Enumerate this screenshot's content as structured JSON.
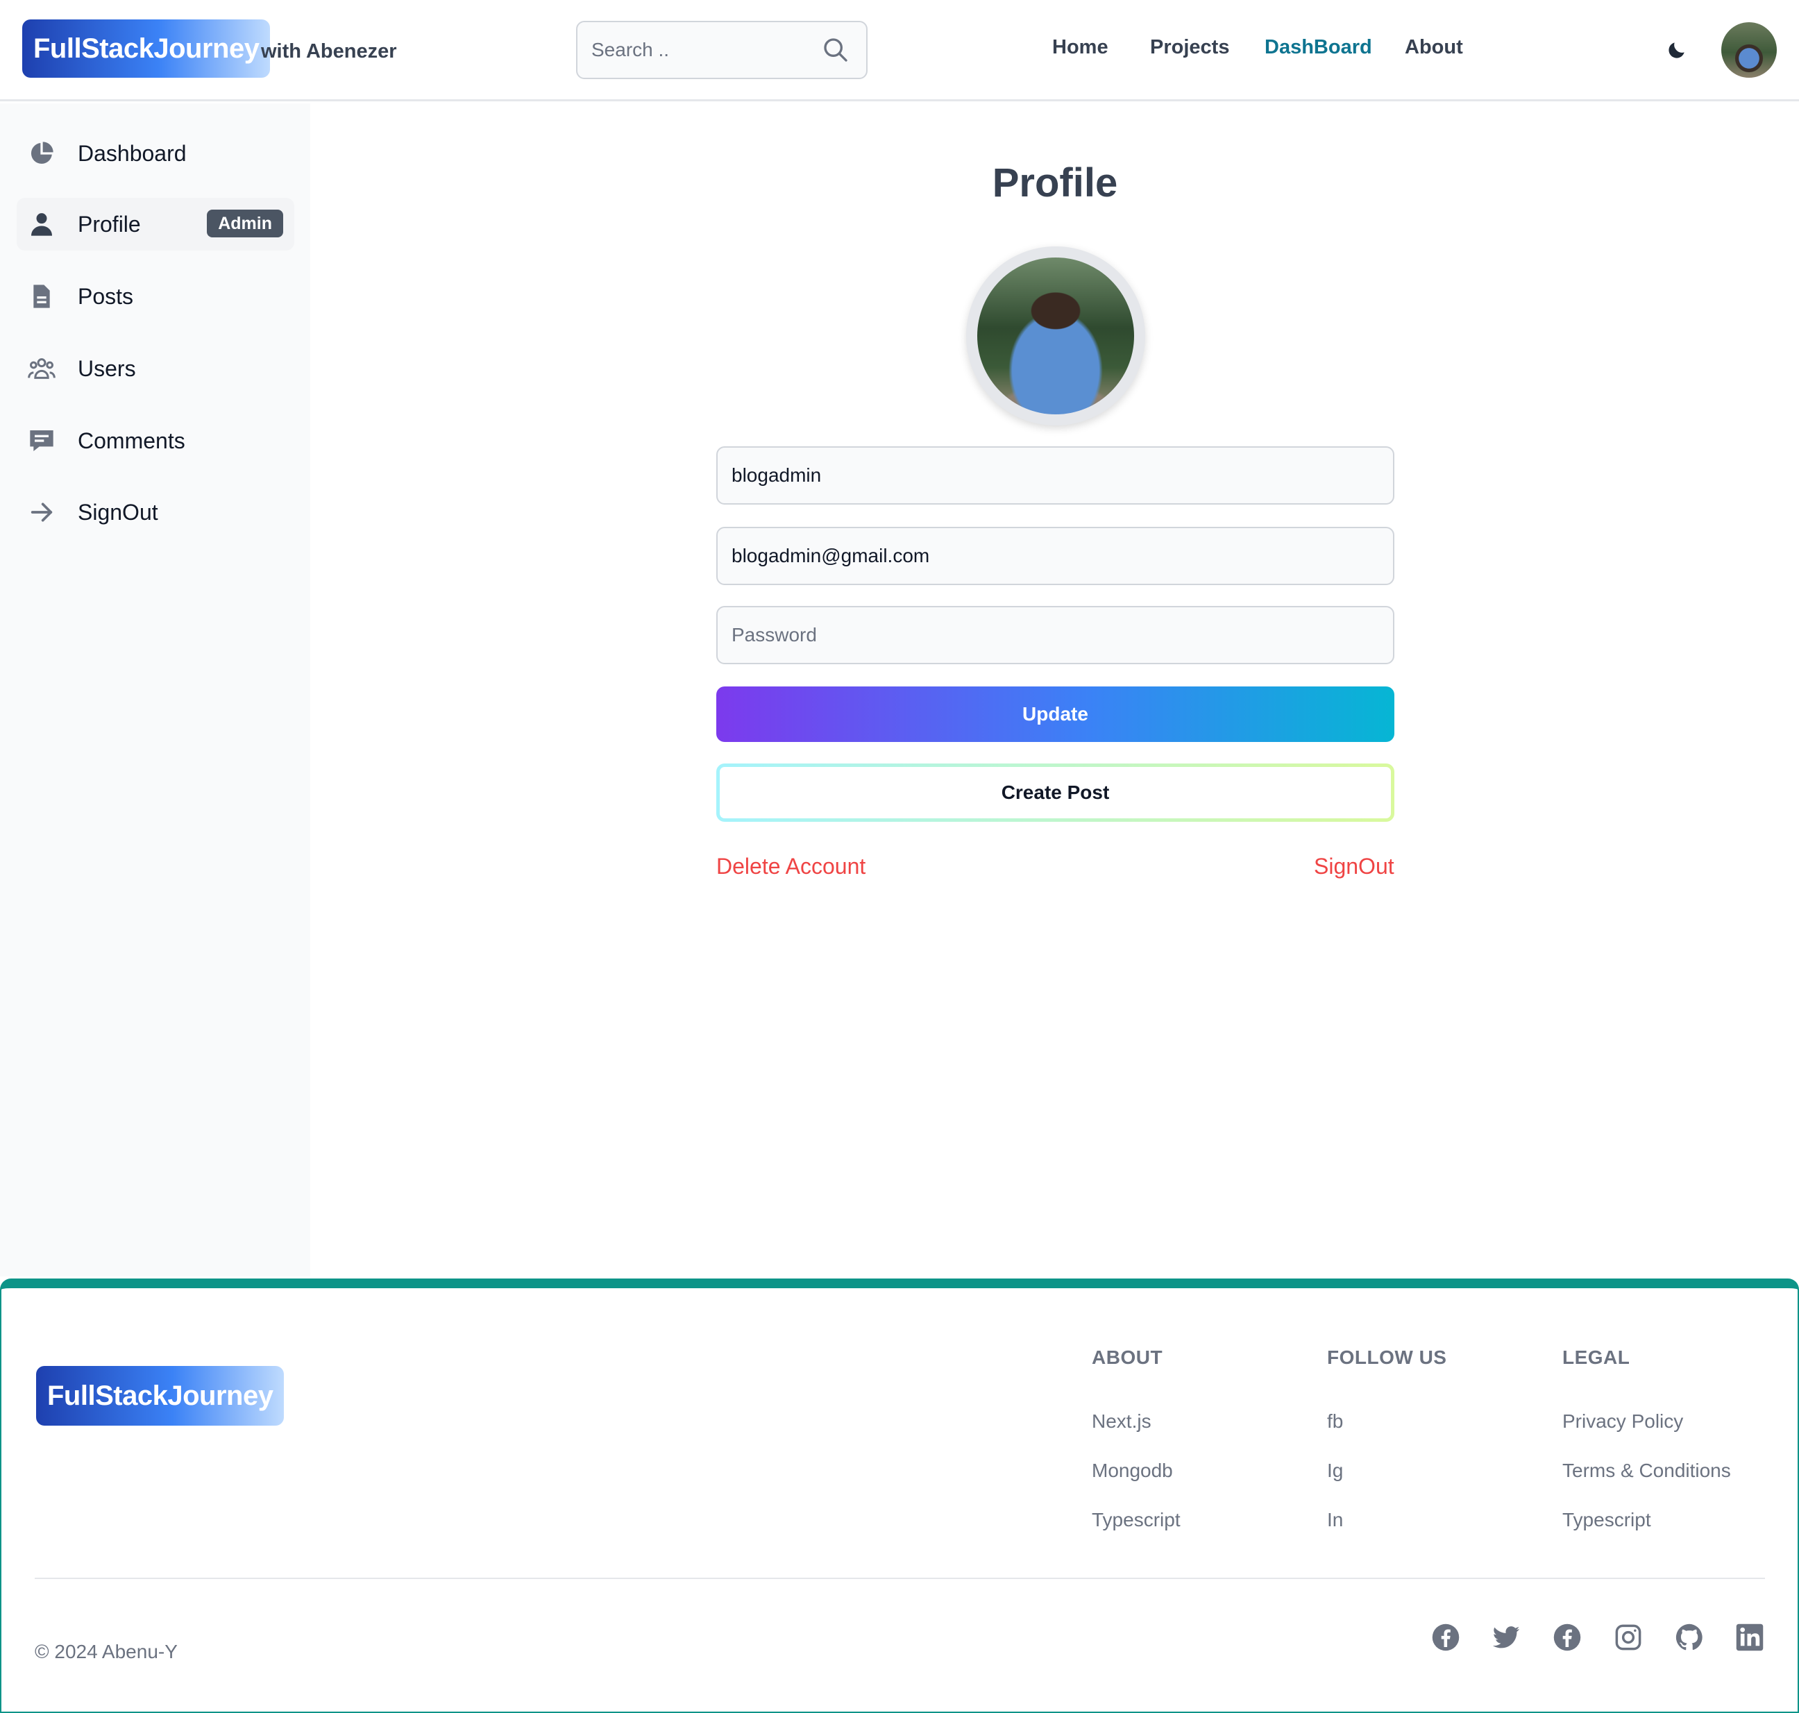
{
  "header": {
    "logo_text": "FullStackJourney",
    "logo_suffix": "with Abenezer",
    "search_placeholder": "Search ..",
    "nav": [
      {
        "label": "Home"
      },
      {
        "label": "Projects"
      },
      {
        "label": "DashBoard"
      },
      {
        "label": "About"
      }
    ],
    "active_nav": "DashBoard",
    "accent_color": "#0e7490"
  },
  "sidebar": {
    "items": [
      {
        "label": "Dashboard",
        "icon": "pie-chart-icon"
      },
      {
        "label": "Profile",
        "icon": "user-icon",
        "badge": "Admin"
      },
      {
        "label": "Posts",
        "icon": "document-icon"
      },
      {
        "label": "Users",
        "icon": "users-group-icon"
      },
      {
        "label": "Comments",
        "icon": "comment-icon"
      },
      {
        "label": "SignOut",
        "icon": "arrow-right-icon"
      }
    ],
    "active_item": "Profile"
  },
  "main": {
    "title": "Profile",
    "username_value": "blogadmin",
    "email_value": "blogadmin@gmail.com",
    "password_placeholder": "Password",
    "update_label": "Update",
    "create_post_label": "Create Post",
    "delete_account_label": "Delete Account",
    "signout_label": "SignOut",
    "danger_color": "#ef4444"
  },
  "footer": {
    "logo_text": "FullStackJourney",
    "columns": [
      {
        "title": "ABOUT",
        "links": [
          "Next.js",
          "Mongodb",
          "Typescript"
        ]
      },
      {
        "title": "FOLLOW US",
        "links": [
          "fb",
          "Ig",
          "In"
        ]
      },
      {
        "title": "LEGAL",
        "links": [
          "Privacy Policy",
          "Terms & Conditions",
          "Typescript"
        ]
      }
    ],
    "copyright": "© 2024 Abenu-Y",
    "social_icons": [
      "facebook-icon",
      "twitter-icon",
      "facebook-icon",
      "instagram-icon",
      "github-icon",
      "linkedin-icon"
    ],
    "border_color": "#0d9488"
  }
}
